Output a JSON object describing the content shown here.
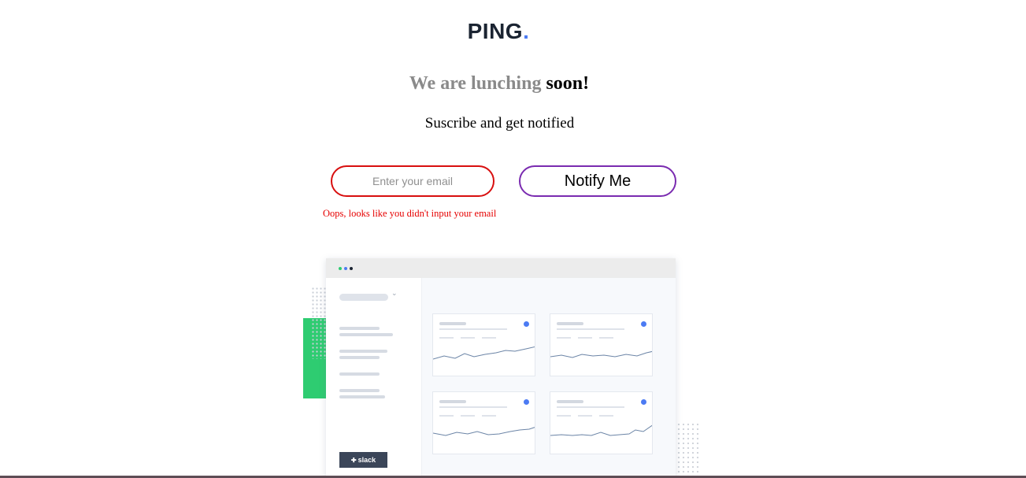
{
  "brand": {
    "name": "PING",
    "dot": ".",
    "accent": "#4c7bf3"
  },
  "hero": {
    "title_muted": "We are lunching",
    "title_strong": "soon!",
    "subtitle": "Suscribe and get notified"
  },
  "form": {
    "email_placeholder": "Enter your email",
    "email_value": "",
    "button_label": "Notify Me",
    "error_text": "Oops, looks like you didn't input your email",
    "error_color": "#e60000"
  },
  "illustration": {
    "slack_label": "slack",
    "slack_mark": "✚",
    "chevron": "⌄"
  }
}
